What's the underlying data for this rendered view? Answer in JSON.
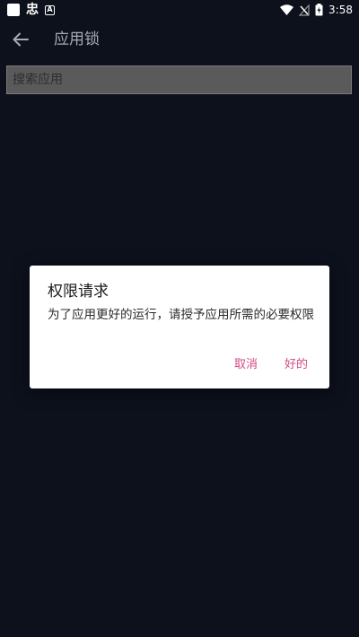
{
  "status_bar": {
    "app_glyph": "忠",
    "app_a_glyph": "A",
    "time": "3:58"
  },
  "toolbar": {
    "title": "应用锁",
    "back_icon": "arrow-left-icon"
  },
  "search": {
    "placeholder": "搜索应用",
    "value": ""
  },
  "dialog": {
    "title": "权限请求",
    "message": "为了应用更好的运行，请授予应用所需的必要权限",
    "cancel_label": "取消",
    "ok_label": "好的",
    "accent_color": "#d24b86"
  },
  "colors": {
    "background": "#0d111c",
    "dialog_background": "#ffffff"
  }
}
